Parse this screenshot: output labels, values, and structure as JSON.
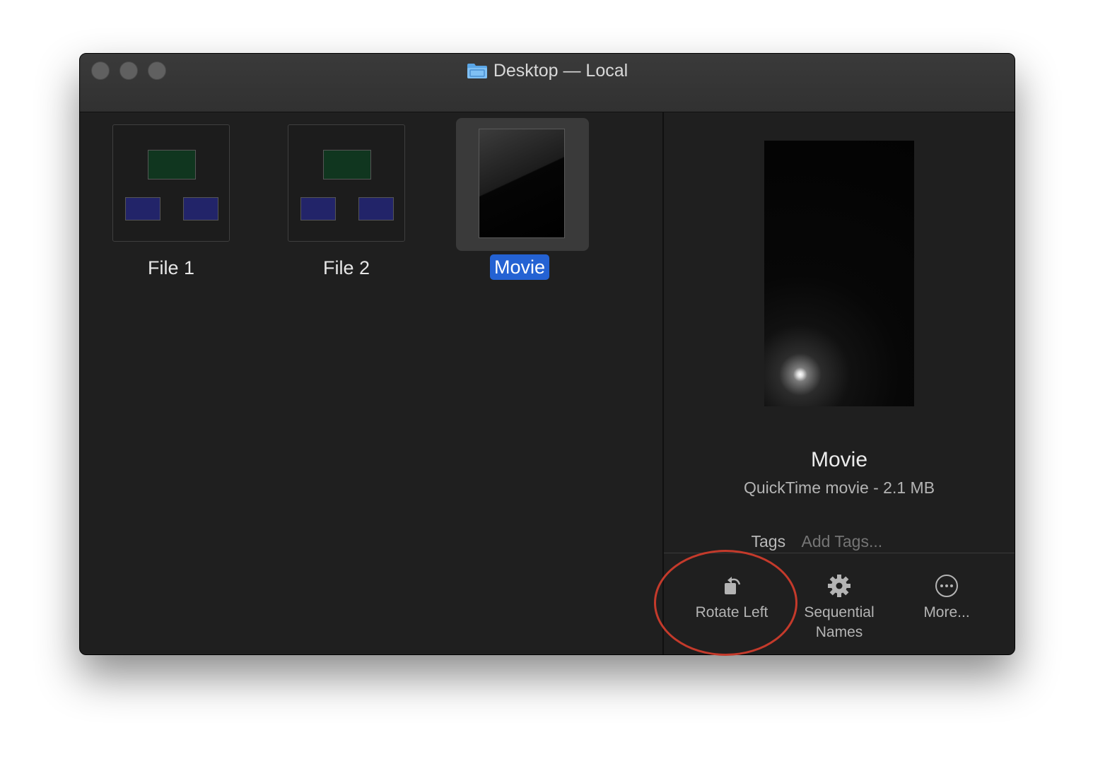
{
  "window": {
    "title": "Desktop — Local",
    "title_icon": "folder-icon",
    "traffic_lights_color": "#606060"
  },
  "files": [
    {
      "name": "File 1",
      "kind": "diagram"
    },
    {
      "name": "File 2",
      "kind": "diagram"
    },
    {
      "name": "Movie",
      "kind": "movie",
      "selected": true
    }
  ],
  "preview": {
    "name": "Movie",
    "info": "QuickTime movie - 2.1 MB",
    "tags_label": "Tags",
    "tags_placeholder": "Add Tags..."
  },
  "actions": [
    {
      "label": "Rotate Left",
      "icon": "rotate-left-icon"
    },
    {
      "label": "Sequential Names",
      "icon": "gear-icon"
    },
    {
      "label": "More...",
      "icon": "more-icon"
    }
  ],
  "colors": {
    "selection": "#2462d3",
    "annotation": "#c43a2b",
    "window_bg": "#1f1f1f"
  }
}
